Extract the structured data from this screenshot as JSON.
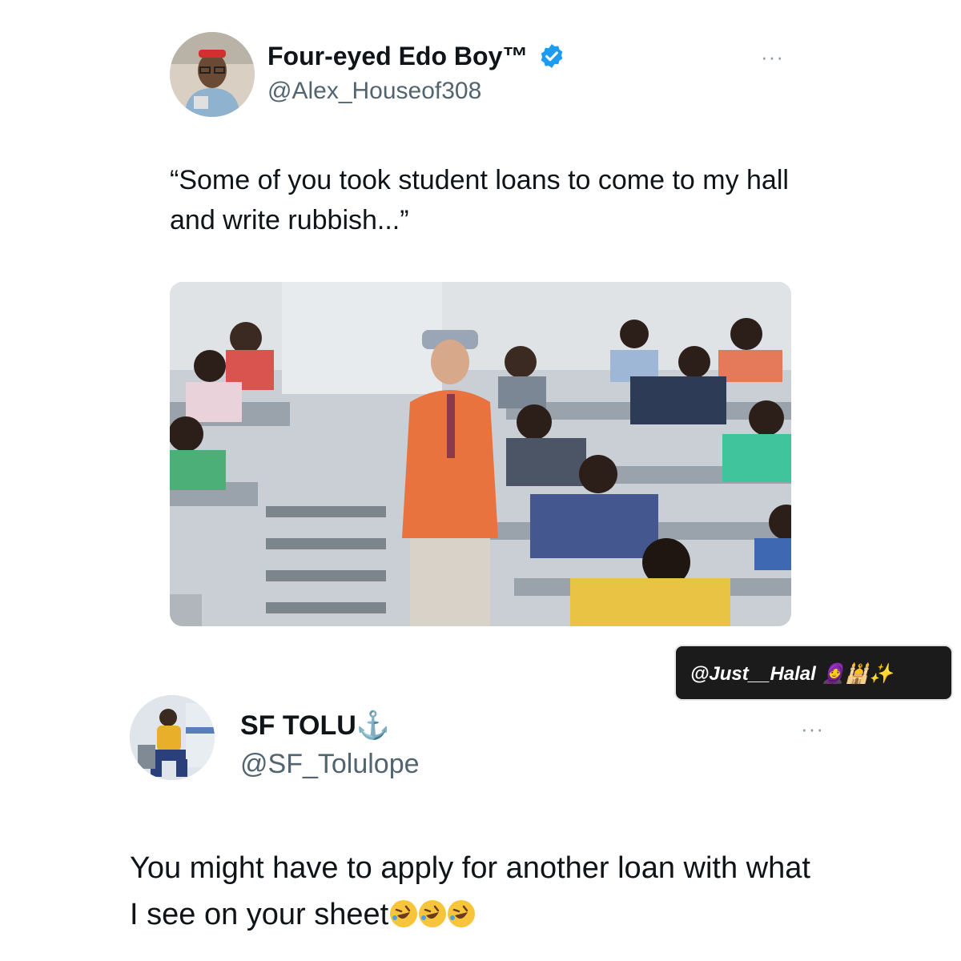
{
  "tweet1": {
    "display_name": "Four-eyed Edo Boy™",
    "handle": "@Alex_Houseof308",
    "verified": true,
    "text": "“Some of you took student loans to come to my hall and write rubbish...”",
    "avatar_icon": "avatar-photo",
    "more_label": "···"
  },
  "watermark": {
    "text": "@Just__Halal 🧕🕌✨"
  },
  "tweet2": {
    "display_name": "SF TOLU⚓",
    "handle": "@SF_Tolulope",
    "text": "You might have to apply for another loan with what I see on your sheet",
    "emoji_count": 3,
    "emoji_icon": "rolling-on-floor-laughing-icon",
    "more_label": "···"
  },
  "colors": {
    "verified_blue": "#1d9bf0",
    "handle_gray": "#536471",
    "text": "#0f1419"
  }
}
